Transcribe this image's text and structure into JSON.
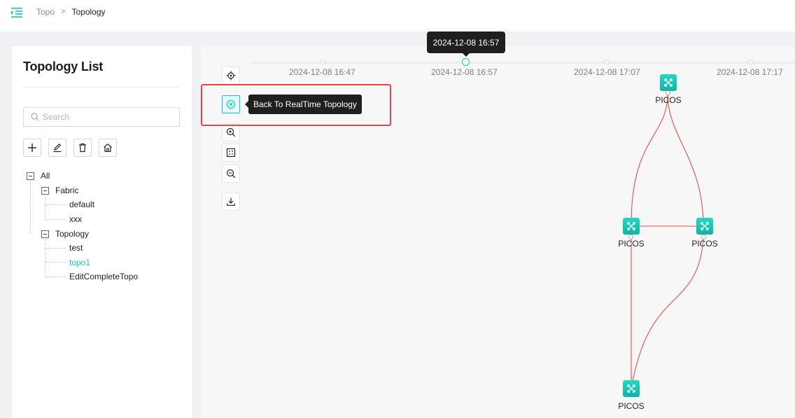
{
  "breadcrumb": {
    "root": "Topo",
    "separator": ">",
    "current": "Topology"
  },
  "left_panel": {
    "title": "Topology List",
    "search_placeholder": "Search",
    "tree": {
      "root": "All",
      "groups": [
        {
          "label": "Fabric",
          "children": [
            "default",
            "xxx"
          ]
        },
        {
          "label": "Topology",
          "children": [
            "test",
            "topo1",
            "EditCompleteTopo"
          ]
        }
      ],
      "selected": "topo1"
    }
  },
  "canvas": {
    "timeline": {
      "labels": [
        "2024-12-08 16:47",
        "2024-12-08 16:57",
        "2024-12-08 17:07",
        "2024-12-08 17:17"
      ],
      "active_tooltip": "2024-12-08 16:57"
    },
    "back_tooltip": "Back To RealTime Topology",
    "nodes": [
      "PICOS",
      "PICOS",
      "PICOS",
      "PICOS"
    ]
  },
  "colors": {
    "accent": "#14c9bb",
    "link": "#ef4b4b",
    "highlight": "#e8454b"
  }
}
